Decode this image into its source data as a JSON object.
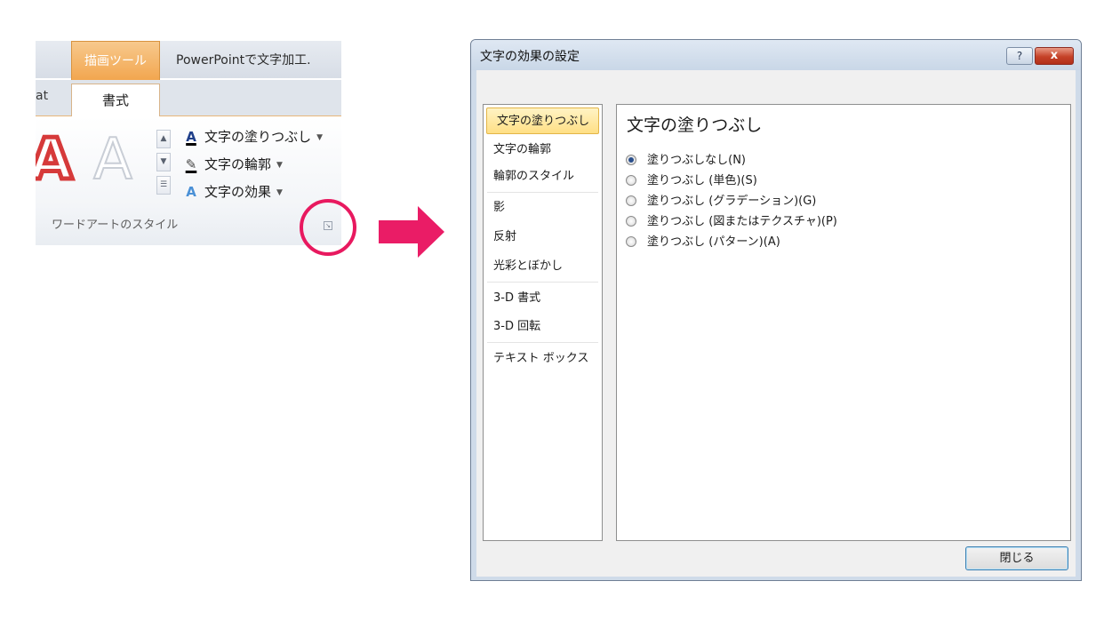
{
  "ribbon": {
    "context_tab_label": "描画ツール",
    "window_title": "PowerPointで文字加工.",
    "partial_tab_label": "at",
    "active_tab_label": "書式",
    "wordart_sample_1": "A",
    "wordart_sample_2": "A",
    "commands": [
      {
        "label": "文字の塗りつぶし",
        "icon": "text-fill-icon",
        "glyph": "A"
      },
      {
        "label": "文字の輪郭",
        "icon": "text-outline-icon",
        "glyph": "✎"
      },
      {
        "label": "文字の効果",
        "icon": "text-effects-icon",
        "glyph": "A"
      }
    ],
    "group_label": "ワードアートのスタイル",
    "launcher_icon": "dialog-launcher-icon"
  },
  "annotation": {
    "circle_color": "#e8195f",
    "arrow_color": "#ea1c66"
  },
  "dialog": {
    "title": "文字の効果の設定",
    "help_glyph": "?",
    "close_glyph": "x",
    "nav_items": [
      "文字の塗りつぶし",
      "文字の輪郭",
      "輪郭のスタイル",
      "影",
      "反射",
      "光彩とぼかし",
      "3-D 書式",
      "3-D 回転",
      "テキスト ボックス"
    ],
    "selected_nav_index": 0,
    "content_heading": "文字の塗りつぶし",
    "fill_options": [
      {
        "label": "塗りつぶしなし(N)",
        "checked": true
      },
      {
        "label": "塗りつぶし (単色)(S)",
        "checked": false
      },
      {
        "label": "塗りつぶし (グラデーション)(G)",
        "checked": false
      },
      {
        "label": "塗りつぶし (図またはテクスチャ)(P)",
        "checked": false
      },
      {
        "label": "塗りつぶし (パターン)(A)",
        "checked": false
      }
    ],
    "close_button_label": "閉じる"
  }
}
